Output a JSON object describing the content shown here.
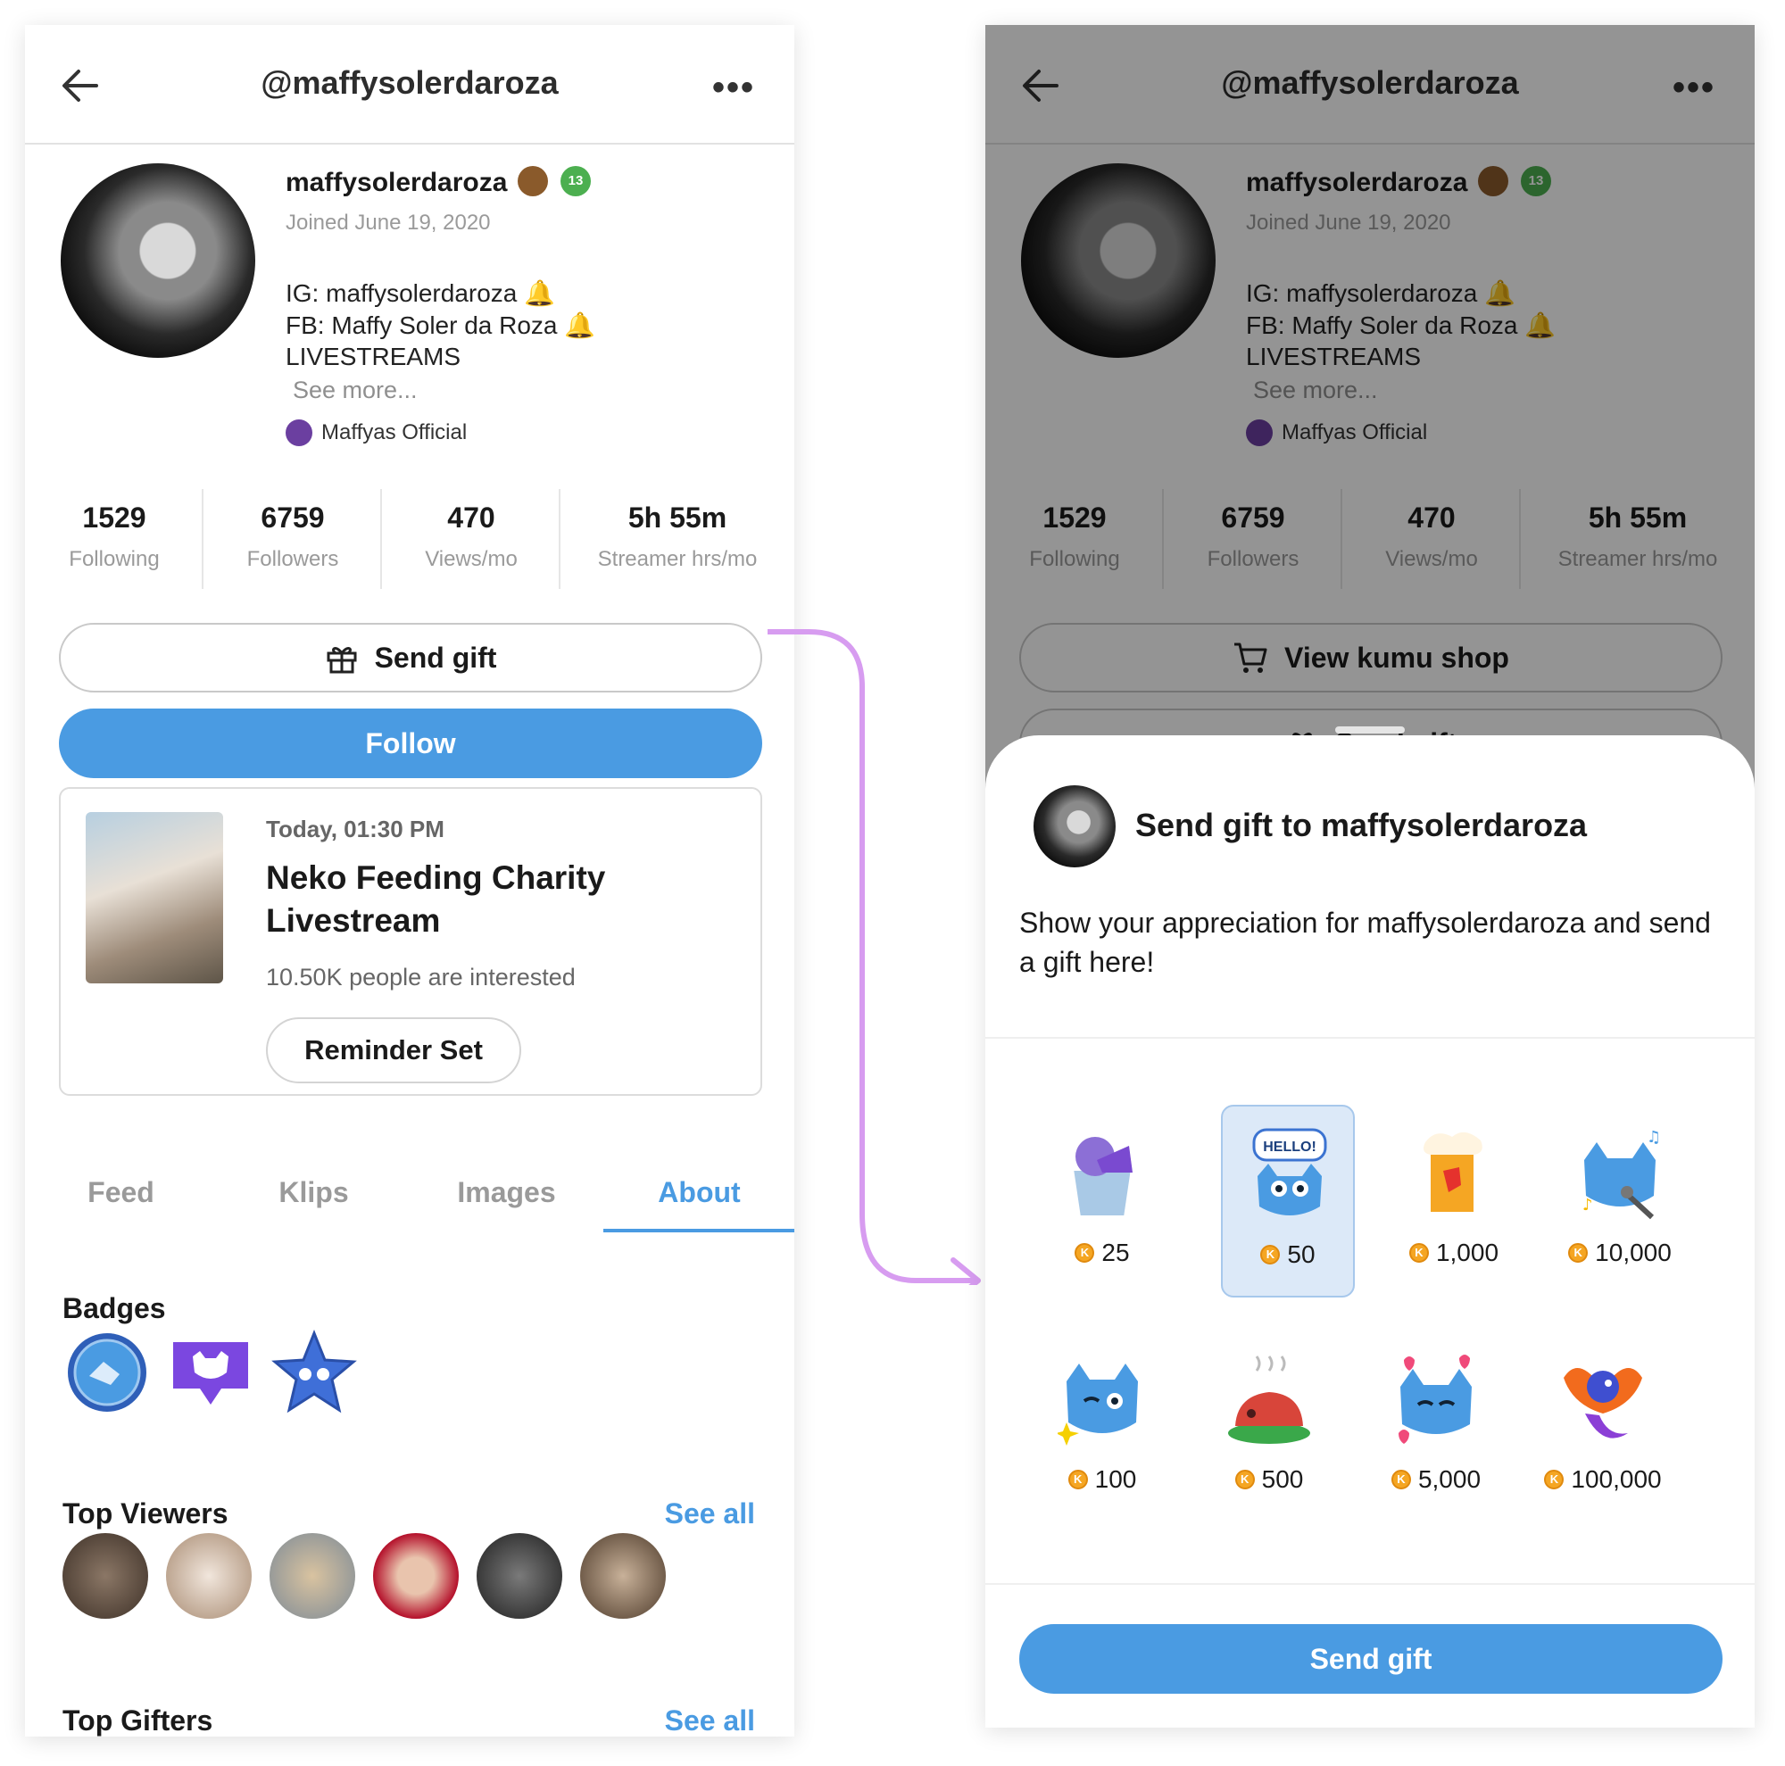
{
  "left_screen": {
    "header": {
      "title": "@maffysolerdaroza"
    },
    "profile": {
      "username": "maffysolerdaroza",
      "level_badge": "13",
      "joined": "Joined June 19, 2020",
      "bio_lines": [
        "IG: maffysolerdaroza 🔔",
        "FB: Maffy Soler da Roza 🔔",
        "LIVESTREAMS"
      ],
      "see_more": "See more...",
      "club": "Maffyas Official"
    },
    "stats": [
      {
        "value": "1529",
        "label": "Following"
      },
      {
        "value": "6759",
        "label": "Followers"
      },
      {
        "value": "470",
        "label": "Views/mo"
      },
      {
        "value": "5h 55m",
        "label": "Streamer hrs/mo"
      }
    ],
    "send_gift_label": "Send gift",
    "follow_label": "Follow",
    "event": {
      "time": "Today, 01:30 PM",
      "title": "Neko Feeding Charity Livestream",
      "interested": "10.50K people are interested",
      "reminder_label": "Reminder Set"
    },
    "tabs": [
      "Feed",
      "Klips",
      "Images",
      "About"
    ],
    "active_tab": "About",
    "badges_title": "Badges",
    "top_viewers_title": "Top Viewers",
    "top_gifters_title": "Top Gifters",
    "see_all": "See all"
  },
  "right_screen": {
    "header": {
      "title": "@maffysolerdaroza"
    },
    "view_shop_label": "View kumu shop",
    "send_gift_behind_label": "Send gift",
    "sheet": {
      "title": "Send gift to maffysolerdaroza",
      "description": "Show your appreciation for maffysolerdaroza and send a gift here!",
      "gifts": [
        {
          "price": "25",
          "icon": "ice-cream-cup"
        },
        {
          "price": "50",
          "icon": "hello-cat",
          "bubble": "HELLO!",
          "selected": true
        },
        {
          "price": "1,000",
          "icon": "beer-mug"
        },
        {
          "price": "10,000",
          "icon": "singing-cat"
        },
        {
          "price": "100",
          "icon": "winking-cat"
        },
        {
          "price": "500",
          "icon": "roast-pig"
        },
        {
          "price": "5,000",
          "icon": "kissing-cat"
        },
        {
          "price": "100,000",
          "icon": "phoenix"
        }
      ],
      "send_label": "Send gift"
    }
  },
  "colors": {
    "accent": "#4a9be2",
    "flow_arrow": "#d79cf0",
    "selected_bg": "#dce9f8"
  }
}
